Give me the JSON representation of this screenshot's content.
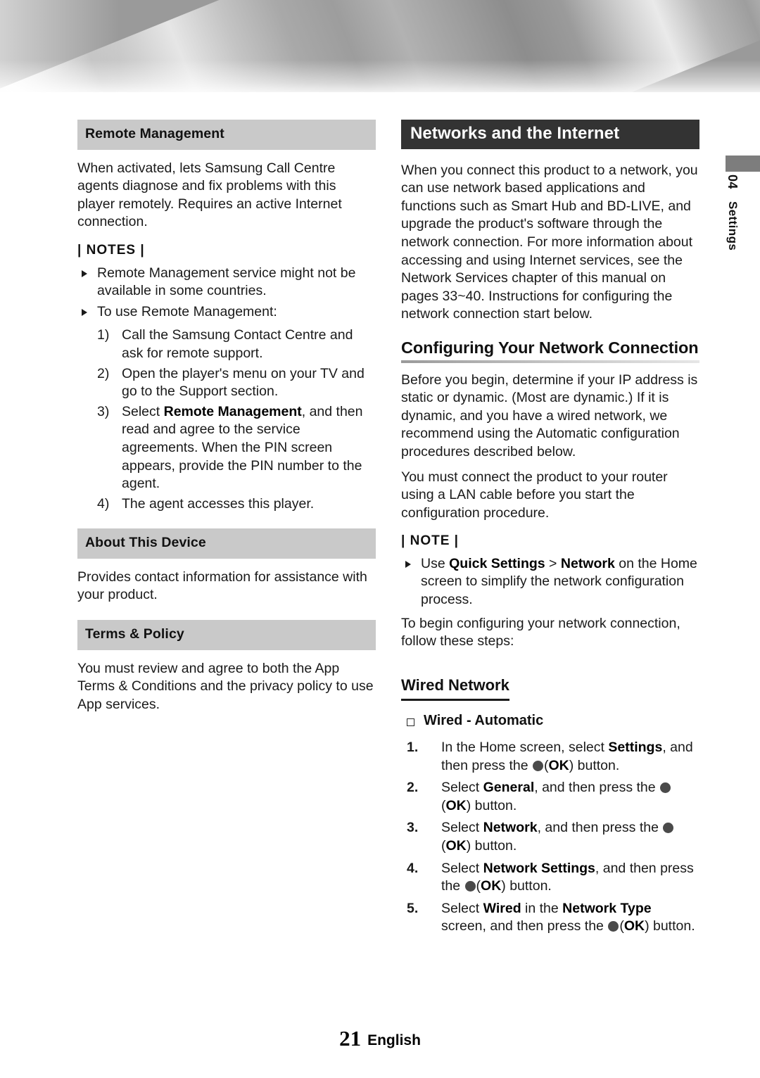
{
  "page": {
    "number": "21",
    "language": "English"
  },
  "side_tab": {
    "chapter_number": "04",
    "chapter_name": "Settings"
  },
  "left_column": {
    "remote_management": {
      "heading": "Remote Management",
      "paragraph": "When activated, lets Samsung Call Centre agents diagnose and fix problems with this player remotely. Requires an active Internet connection.",
      "notes_label": "| NOTES |",
      "notes": [
        {
          "text": "Remote Management service might not be available in some countries."
        },
        {
          "text": "To use Remote Management:"
        }
      ],
      "steps": [
        {
          "marker": "1)",
          "text": "Call the Samsung Contact Centre and ask for remote support."
        },
        {
          "marker": "2)",
          "text": "Open the player's menu on your TV and go to the Support section."
        },
        {
          "marker": "3)",
          "text_before": "Select ",
          "bold": "Remote Management",
          "text_after": ", and then read and agree to the service agreements. When the PIN screen appears, provide the PIN number to the agent."
        },
        {
          "marker": "4)",
          "text": "The agent accesses this player."
        }
      ]
    },
    "about_this_device": {
      "heading": "About This Device",
      "paragraph": "Provides contact information for assistance with your product."
    },
    "terms_policy": {
      "heading": "Terms & Policy",
      "paragraph": "You must review and agree to both the App Terms & Conditions and the privacy policy to use App services."
    }
  },
  "right_column": {
    "networks_header": "Networks and the Internet",
    "networks_intro": "When you connect this product to a network, you can use network based applications and functions such as Smart Hub and BD-LIVE, and upgrade the product's software through the network connection. For more information about accessing and using Internet services, see the Network Services chapter of this manual on pages 33~40. Instructions for configuring the network connection start below.",
    "configuring": {
      "heading": "Configuring Your Network Connection",
      "paragraph_1": "Before you begin, determine if your IP address is static or dynamic. (Most are dynamic.) If it is dynamic, and you have a wired network, we recommend using the Automatic configuration procedures described below.",
      "paragraph_2": "You must connect the product to your router using a LAN cable before you start the configuration procedure.",
      "note_label": "| NOTE |",
      "note_use": "Use ",
      "note_quick_settings": "Quick Settings",
      "note_gt": " > ",
      "note_network": "Network",
      "note_rest": " on the Home screen to simplify the network configuration process.",
      "paragraph_3": "To begin configuring your network connection, follow these steps:"
    },
    "wired_network": {
      "heading": "Wired Network",
      "subheading": "Wired - Automatic",
      "steps": [
        {
          "marker": "1.",
          "part1": "In the Home screen, select ",
          "bold1": "Settings",
          "part2": ", and then press the ",
          "bold2": "OK",
          "part3": ") button.",
          "paren_open": "("
        },
        {
          "marker": "2.",
          "part1": "Select ",
          "bold1": "General",
          "part2": ", and then press the ",
          "bold2": "OK",
          "part3": ") button.",
          "paren_open": "("
        },
        {
          "marker": "3.",
          "part1": "Select ",
          "bold1": "Network",
          "part2": ", and then press the ",
          "bold2": "OK",
          "part3": ") button.",
          "paren_open": "("
        },
        {
          "marker": "4.",
          "part1": "Select ",
          "bold1": "Network Settings",
          "part2": ", and then press the ",
          "bold2": "OK",
          "part3": ") button.",
          "paren_open": "("
        },
        {
          "marker": "5.",
          "part1": "Select ",
          "bold1": "Wired",
          "part1b": " in the ",
          "bold1b": "Network Type",
          "part2": " screen, and then press the ",
          "bold2": "OK",
          "part3": ") button.",
          "paren_open": "("
        }
      ]
    }
  },
  "colors": {
    "section_bar_gray": "#c9c9c9",
    "section_bar_dark": "#333333",
    "ok_dot": "#4a4a4a",
    "side_tab_marker": "#7d7d7d"
  }
}
